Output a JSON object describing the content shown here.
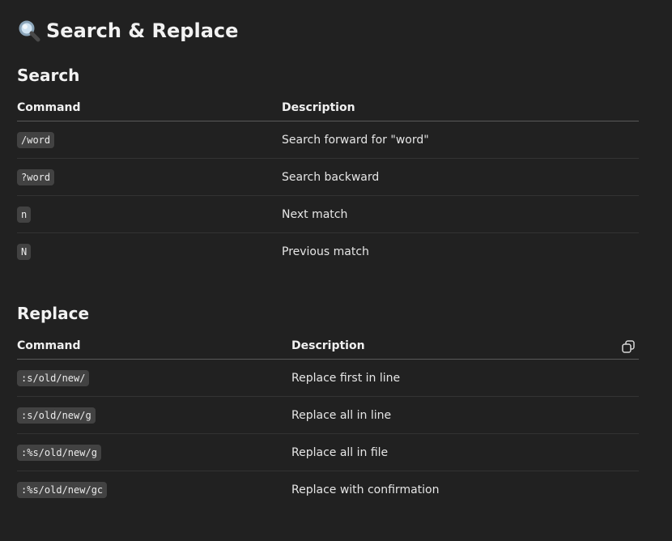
{
  "page": {
    "title_icon": "magnifier-icon",
    "title": "Search & Replace"
  },
  "search": {
    "heading": "Search",
    "headers": {
      "command": "Command",
      "description": "Description"
    },
    "rows": [
      {
        "command": "/word",
        "description": "Search forward for \"word\""
      },
      {
        "command": "?word",
        "description": "Search backward"
      },
      {
        "command": "n",
        "description": "Next match"
      },
      {
        "command": "N",
        "description": "Previous match"
      }
    ]
  },
  "replace": {
    "heading": "Replace",
    "headers": {
      "command": "Command",
      "description": "Description"
    },
    "copy_icon": "copy-icon",
    "rows": [
      {
        "command": ":s/old/new/",
        "description": "Replace first in line"
      },
      {
        "command": ":s/old/new/g",
        "description": "Replace all in line"
      },
      {
        "command": ":%s/old/new/g",
        "description": "Replace all in file"
      },
      {
        "command": ":%s/old/new/gc",
        "description": "Replace with confirmation"
      }
    ]
  },
  "colors": {
    "background": "#212121",
    "code_background": "#424242",
    "text": "#ececec"
  }
}
